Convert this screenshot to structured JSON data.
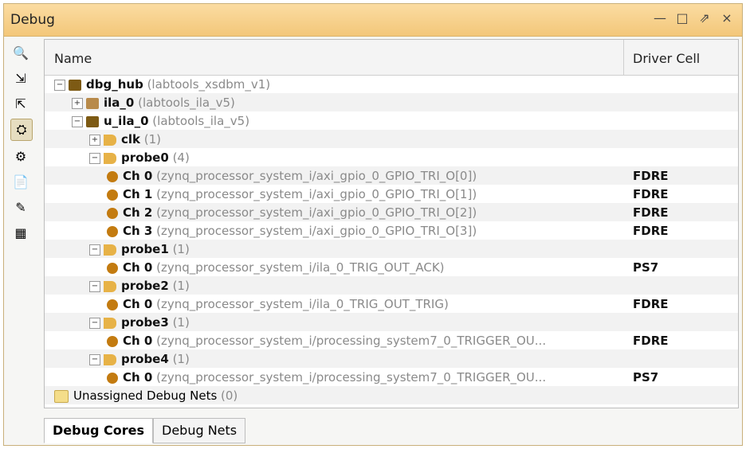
{
  "window": {
    "title": "Debug",
    "controls": {
      "minimize": "—",
      "maximize": "□",
      "restore": "⇗",
      "close": "×"
    }
  },
  "toolbar": [
    {
      "name": "search-icon",
      "glyph": "🔍"
    },
    {
      "name": "expand-icon",
      "glyph": "⇲"
    },
    {
      "name": "collapse-icon",
      "glyph": "⇱"
    },
    {
      "name": "link-icon",
      "glyph": "⛭"
    },
    {
      "name": "settings-icon",
      "glyph": "⚙"
    },
    {
      "name": "report-icon",
      "glyph": "📄"
    },
    {
      "name": "export-icon",
      "glyph": "✎"
    },
    {
      "name": "disabled-icon",
      "glyph": "▦"
    }
  ],
  "table": {
    "headers": {
      "name": "Name",
      "driver": "Driver Cell"
    },
    "rows": [
      {
        "indent": 0,
        "exp": "−",
        "icon": "hub",
        "bold": "dbg_hub",
        "grey": "(labtools_xsdbm_v1)",
        "driver": ""
      },
      {
        "indent": 1,
        "exp": "+",
        "icon": "ila",
        "bold": "ila_0",
        "grey": "(labtools_ila_v5)",
        "driver": ""
      },
      {
        "indent": 1,
        "exp": "−",
        "icon": "hub",
        "bold": "u_ila_0",
        "grey": "(labtools_ila_v5)",
        "driver": ""
      },
      {
        "indent": 2,
        "exp": "+",
        "icon": "bus",
        "bold": "clk",
        "grey": "(1)",
        "driver": ""
      },
      {
        "indent": 2,
        "exp": "−",
        "icon": "bus",
        "bold": "probe0",
        "grey": "(4)",
        "driver": ""
      },
      {
        "indent": 3,
        "exp": "",
        "icon": "net",
        "bold": "Ch 0",
        "grey": "(zynq_processor_system_i/axi_gpio_0_GPIO_TRI_O[0])",
        "driver": "FDRE"
      },
      {
        "indent": 3,
        "exp": "",
        "icon": "net",
        "bold": "Ch 1",
        "grey": "(zynq_processor_system_i/axi_gpio_0_GPIO_TRI_O[1])",
        "driver": "FDRE"
      },
      {
        "indent": 3,
        "exp": "",
        "icon": "net",
        "bold": "Ch 2",
        "grey": "(zynq_processor_system_i/axi_gpio_0_GPIO_TRI_O[2])",
        "driver": "FDRE"
      },
      {
        "indent": 3,
        "exp": "",
        "icon": "net",
        "bold": "Ch 3",
        "grey": "(zynq_processor_system_i/axi_gpio_0_GPIO_TRI_O[3])",
        "driver": "FDRE"
      },
      {
        "indent": 2,
        "exp": "−",
        "icon": "bus",
        "bold": "probe1",
        "grey": "(1)",
        "driver": ""
      },
      {
        "indent": 3,
        "exp": "",
        "icon": "net",
        "bold": "Ch 0",
        "grey": "(zynq_processor_system_i/ila_0_TRIG_OUT_ACK)",
        "driver": "PS7"
      },
      {
        "indent": 2,
        "exp": "−",
        "icon": "bus",
        "bold": "probe2",
        "grey": "(1)",
        "driver": ""
      },
      {
        "indent": 3,
        "exp": "",
        "icon": "net",
        "bold": "Ch 0",
        "grey": "(zynq_processor_system_i/ila_0_TRIG_OUT_TRIG)",
        "driver": "FDRE"
      },
      {
        "indent": 2,
        "exp": "−",
        "icon": "bus",
        "bold": "probe3",
        "grey": "(1)",
        "driver": ""
      },
      {
        "indent": 3,
        "exp": "",
        "icon": "net",
        "bold": "Ch 0",
        "grey": "(zynq_processor_system_i/processing_system7_0_TRIGGER_OU...",
        "driver": "FDRE"
      },
      {
        "indent": 2,
        "exp": "−",
        "icon": "bus",
        "bold": "probe4",
        "grey": "(1)",
        "driver": ""
      },
      {
        "indent": 3,
        "exp": "",
        "icon": "net",
        "bold": "Ch 0",
        "grey": "(zynq_processor_system_i/processing_system7_0_TRIGGER_OU...",
        "driver": "PS7"
      },
      {
        "indent": 0,
        "exp": "",
        "icon": "folder",
        "bold": "Unassigned Debug Nets",
        "grey": "(0)",
        "driver": "",
        "plain": true
      }
    ]
  },
  "tabs": [
    {
      "label": "Debug Cores",
      "active": true
    },
    {
      "label": "Debug Nets",
      "active": false
    }
  ],
  "colors": {
    "title_bar": "#f3c77a",
    "border": "#c9b07a"
  }
}
